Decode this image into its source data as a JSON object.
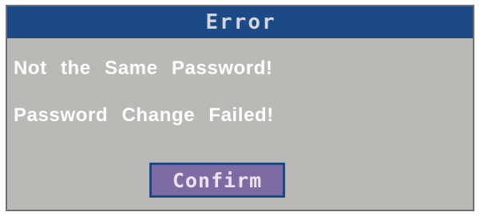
{
  "dialog": {
    "title": "Error",
    "messages": [
      "Not the Same Password!",
      "Password Change Failed!"
    ],
    "confirm_label": "Confirm"
  },
  "colors": {
    "title_bar": "#1c4a86",
    "dialog_background": "#b9bab6",
    "button_fill": "#7e6ba3",
    "button_border": "#1c4a86",
    "message_text": "#ffffff"
  }
}
